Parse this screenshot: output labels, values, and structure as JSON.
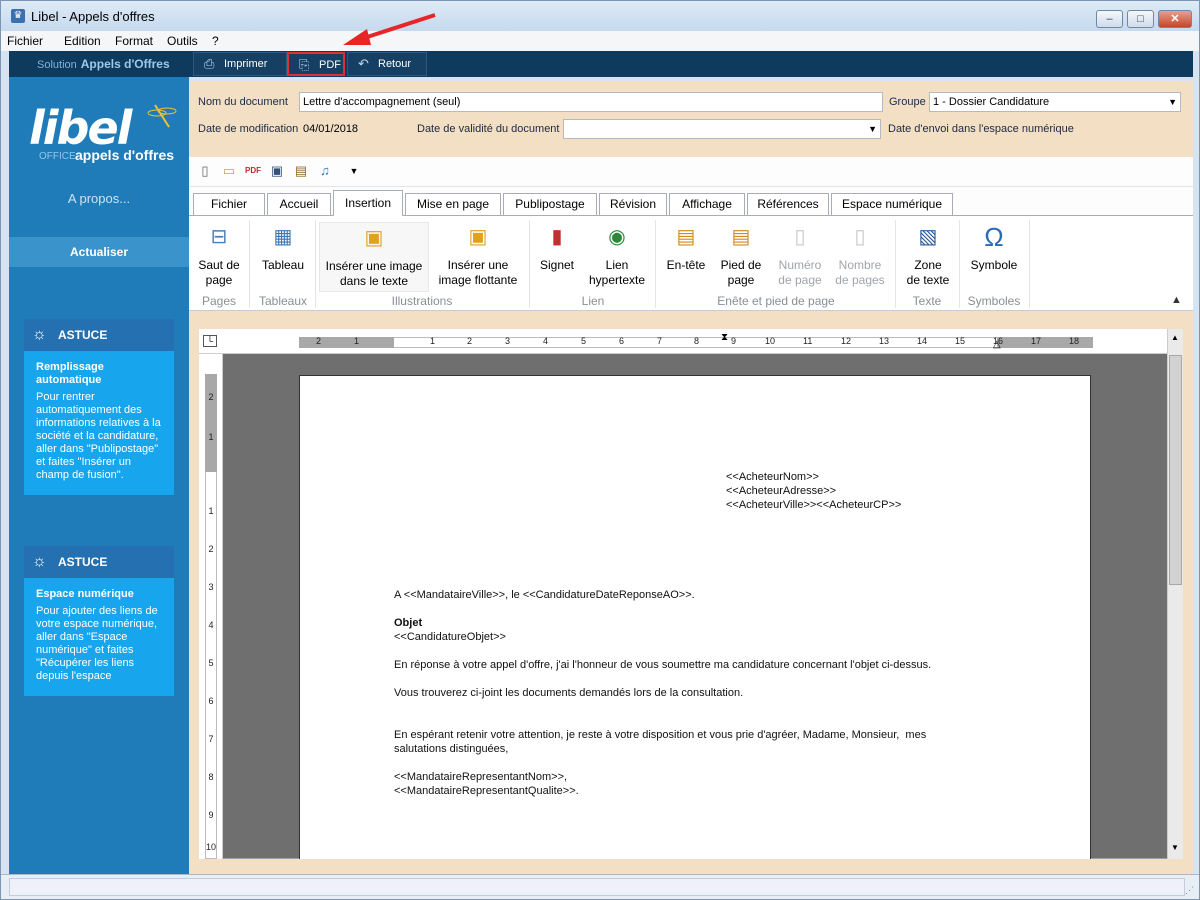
{
  "window": {
    "title": "Libel - Appels d'offres",
    "app_icon": "trophy-icon",
    "min": "–",
    "max": "□",
    "close": "✕"
  },
  "menu": [
    "Fichier",
    "Edition",
    "Format",
    "Outils",
    "?"
  ],
  "toolbar": {
    "solution_label": "Solution",
    "solution_name": "Appels d'Offres",
    "buttons": [
      {
        "label": "Imprimer",
        "icon": "printer-icon"
      },
      {
        "label": "PDF",
        "icon": "pdf-icon"
      },
      {
        "label": "Retour",
        "icon": "undo-icon"
      }
    ]
  },
  "sidebar": {
    "logo_main": "libel",
    "logo_sub1": "OFFICE",
    "logo_sub2": "appels d'offres",
    "apropos": "A propos...",
    "actualiser": "Actualiser",
    "astuces": [
      {
        "head": "ASTUCE",
        "title": "Remplissage automatique",
        "body": "Pour rentrer automatiquement des informations relatives à la société et la candidature, aller dans \"Publipostage\" et faites \"Insérer un champ de fusion\"."
      },
      {
        "head": "ASTUCE",
        "title": "Espace numérique",
        "body": "Pour ajouter des liens de votre espace numérique, aller dans \"Espace numérique\" et faites \"Récupérer les liens depuis l'espace"
      }
    ]
  },
  "form": {
    "nom_label": "Nom du document",
    "nom_value": "Lettre d'accompagnement (seul)",
    "groupe_label": "Groupe",
    "groupe_value": "1 - Dossier Candidature",
    "modif_label": "Date de modification",
    "modif_value": "04/01/2018",
    "validite_label": "Date de validité du document",
    "validite_value": "",
    "envoi_label": "Date d'envoi dans l'espace numérique"
  },
  "tabs": [
    "Fichier",
    "Accueil",
    "Insertion",
    "Mise en page",
    "Publipostage",
    "Révision",
    "Affichage",
    "Références",
    "Espace numérique"
  ],
  "active_tab": "Insertion",
  "ribbon": {
    "buttons": [
      {
        "l1": "Saut de",
        "l2": "page",
        "icon": "page-break-icon"
      },
      {
        "l1": "Tableau",
        "l2": "",
        "icon": "table-icon"
      },
      {
        "l1": "Insérer une image",
        "l2": "dans le texte",
        "icon": "image-inline-icon"
      },
      {
        "l1": "Insérer une",
        "l2": "image flottante",
        "icon": "image-float-icon"
      },
      {
        "l1": "Signet",
        "l2": "",
        "icon": "bookmark-icon"
      },
      {
        "l1": "Lien",
        "l2": "hypertexte",
        "icon": "hyperlink-icon"
      },
      {
        "l1": "En-tête",
        "l2": "",
        "icon": "header-icon"
      },
      {
        "l1": "Pied de",
        "l2": "page",
        "icon": "footer-icon"
      },
      {
        "l1": "Numéro",
        "l2": "de page",
        "icon": "page-number-icon"
      },
      {
        "l1": "Nombre",
        "l2": "de pages",
        "icon": "page-count-icon"
      },
      {
        "l1": "Zone",
        "l2": "de texte",
        "icon": "textbox-icon"
      },
      {
        "l1": "Symbole",
        "l2": "",
        "icon": "omega-icon"
      }
    ],
    "groups": [
      "Pages",
      "Tableaux",
      "Illustrations",
      "Lien",
      "Enête et pied de page",
      "Texte",
      "Symboles"
    ]
  },
  "ruler": {
    "h_numbers": [
      "2",
      "1",
      "1",
      "2",
      "3",
      "4",
      "5",
      "6",
      "7",
      "8",
      "9",
      "10",
      "11",
      "12",
      "13",
      "14",
      "15",
      "16",
      "17",
      "18"
    ],
    "v_numbers": [
      "2",
      "1",
      "1",
      "2",
      "3",
      "4",
      "5",
      "6",
      "7",
      "8",
      "9",
      "10"
    ]
  },
  "document": {
    "addr1": "<<AcheteurNom>>",
    "addr2": "<<AcheteurAdresse>>",
    "addr3": "<<AcheteurVille>><<AcheteurCP>>",
    "line_date": "A <<MandataireVille>>, le <<CandidatureDateReponseAO>>.",
    "objet_label": "Objet",
    "objet_value": "<<CandidatureObjet>>",
    "p1": "En réponse à votre appel d'offre, j'ai l'honneur de vous soumettre ma candidature concernant l'objet ci-dessus.",
    "p2": "Vous trouverez ci-joint les documents demandés lors de la consultation.",
    "p3a": "En espérant retenir votre attention, je reste à votre disposition et vous prie d'agréer, Madame, Monsieur,  mes",
    "p3b": "salutations distinguées,",
    "sig1": "<<MandataireRepresentantNom>>,",
    "sig2": "<<MandataireRepresentantQualite>>."
  }
}
